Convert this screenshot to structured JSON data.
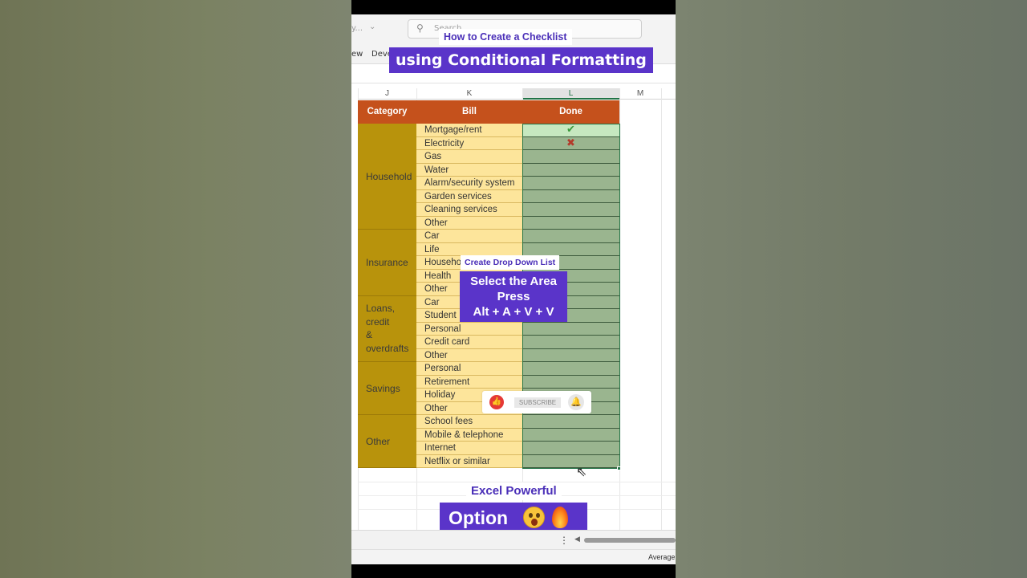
{
  "overlay": {
    "title_small": "How to Create a Checklist",
    "title_big": "using Conditional Formatting",
    "tip_small": "Create Drop Down List",
    "tip_lines": [
      "Select the Area",
      "Press",
      "Alt + A + V + V"
    ],
    "bottom_small": "Excel Powerful",
    "bottom_big": "Option"
  },
  "ribbon": {
    "file_name": "y...",
    "search_placeholder": "Search",
    "menu_view": "ew",
    "menu_developer": "Deve"
  },
  "sheet": {
    "columns": [
      "J",
      "K",
      "L",
      "M"
    ],
    "headers": {
      "category": "Category",
      "bill": "Bill",
      "done": "Done"
    },
    "groups": [
      {
        "category": "Household",
        "bills": [
          "Mortgage/rent",
          "Electricity",
          "Gas",
          "Water",
          "Alarm/security system",
          "Garden services",
          "Cleaning services",
          "Other"
        ]
      },
      {
        "category": "Insurance",
        "bills": [
          "Car",
          "Life",
          "Household",
          "Health",
          "Other"
        ]
      },
      {
        "category": "Loans, credit & overdrafts",
        "category_lines": [
          "Loans,",
          "credit",
          "&",
          "overdrafts"
        ],
        "bills": [
          "Car",
          "Student",
          "Personal",
          "Credit card",
          "Other"
        ]
      },
      {
        "category": "Savings",
        "bills": [
          "Personal",
          "Retirement",
          "Holiday",
          "Other"
        ]
      },
      {
        "category": "Other",
        "bills": [
          "School fees",
          "Mobile & telephone",
          "Internet",
          "Netflix or similar"
        ]
      }
    ],
    "done_marks": [
      "✔",
      "✖"
    ]
  },
  "subscribe": {
    "label": "SUBSCRIBE"
  },
  "status": {
    "average_label": "Average:"
  },
  "colors": {
    "header_bg": "#c5511c",
    "category_bg": "#b8930c",
    "bill_bg": "#fde59b",
    "done_bg": "#9ab58f",
    "overlay_purple": "#5a34c9",
    "selection_green": "#217346"
  }
}
